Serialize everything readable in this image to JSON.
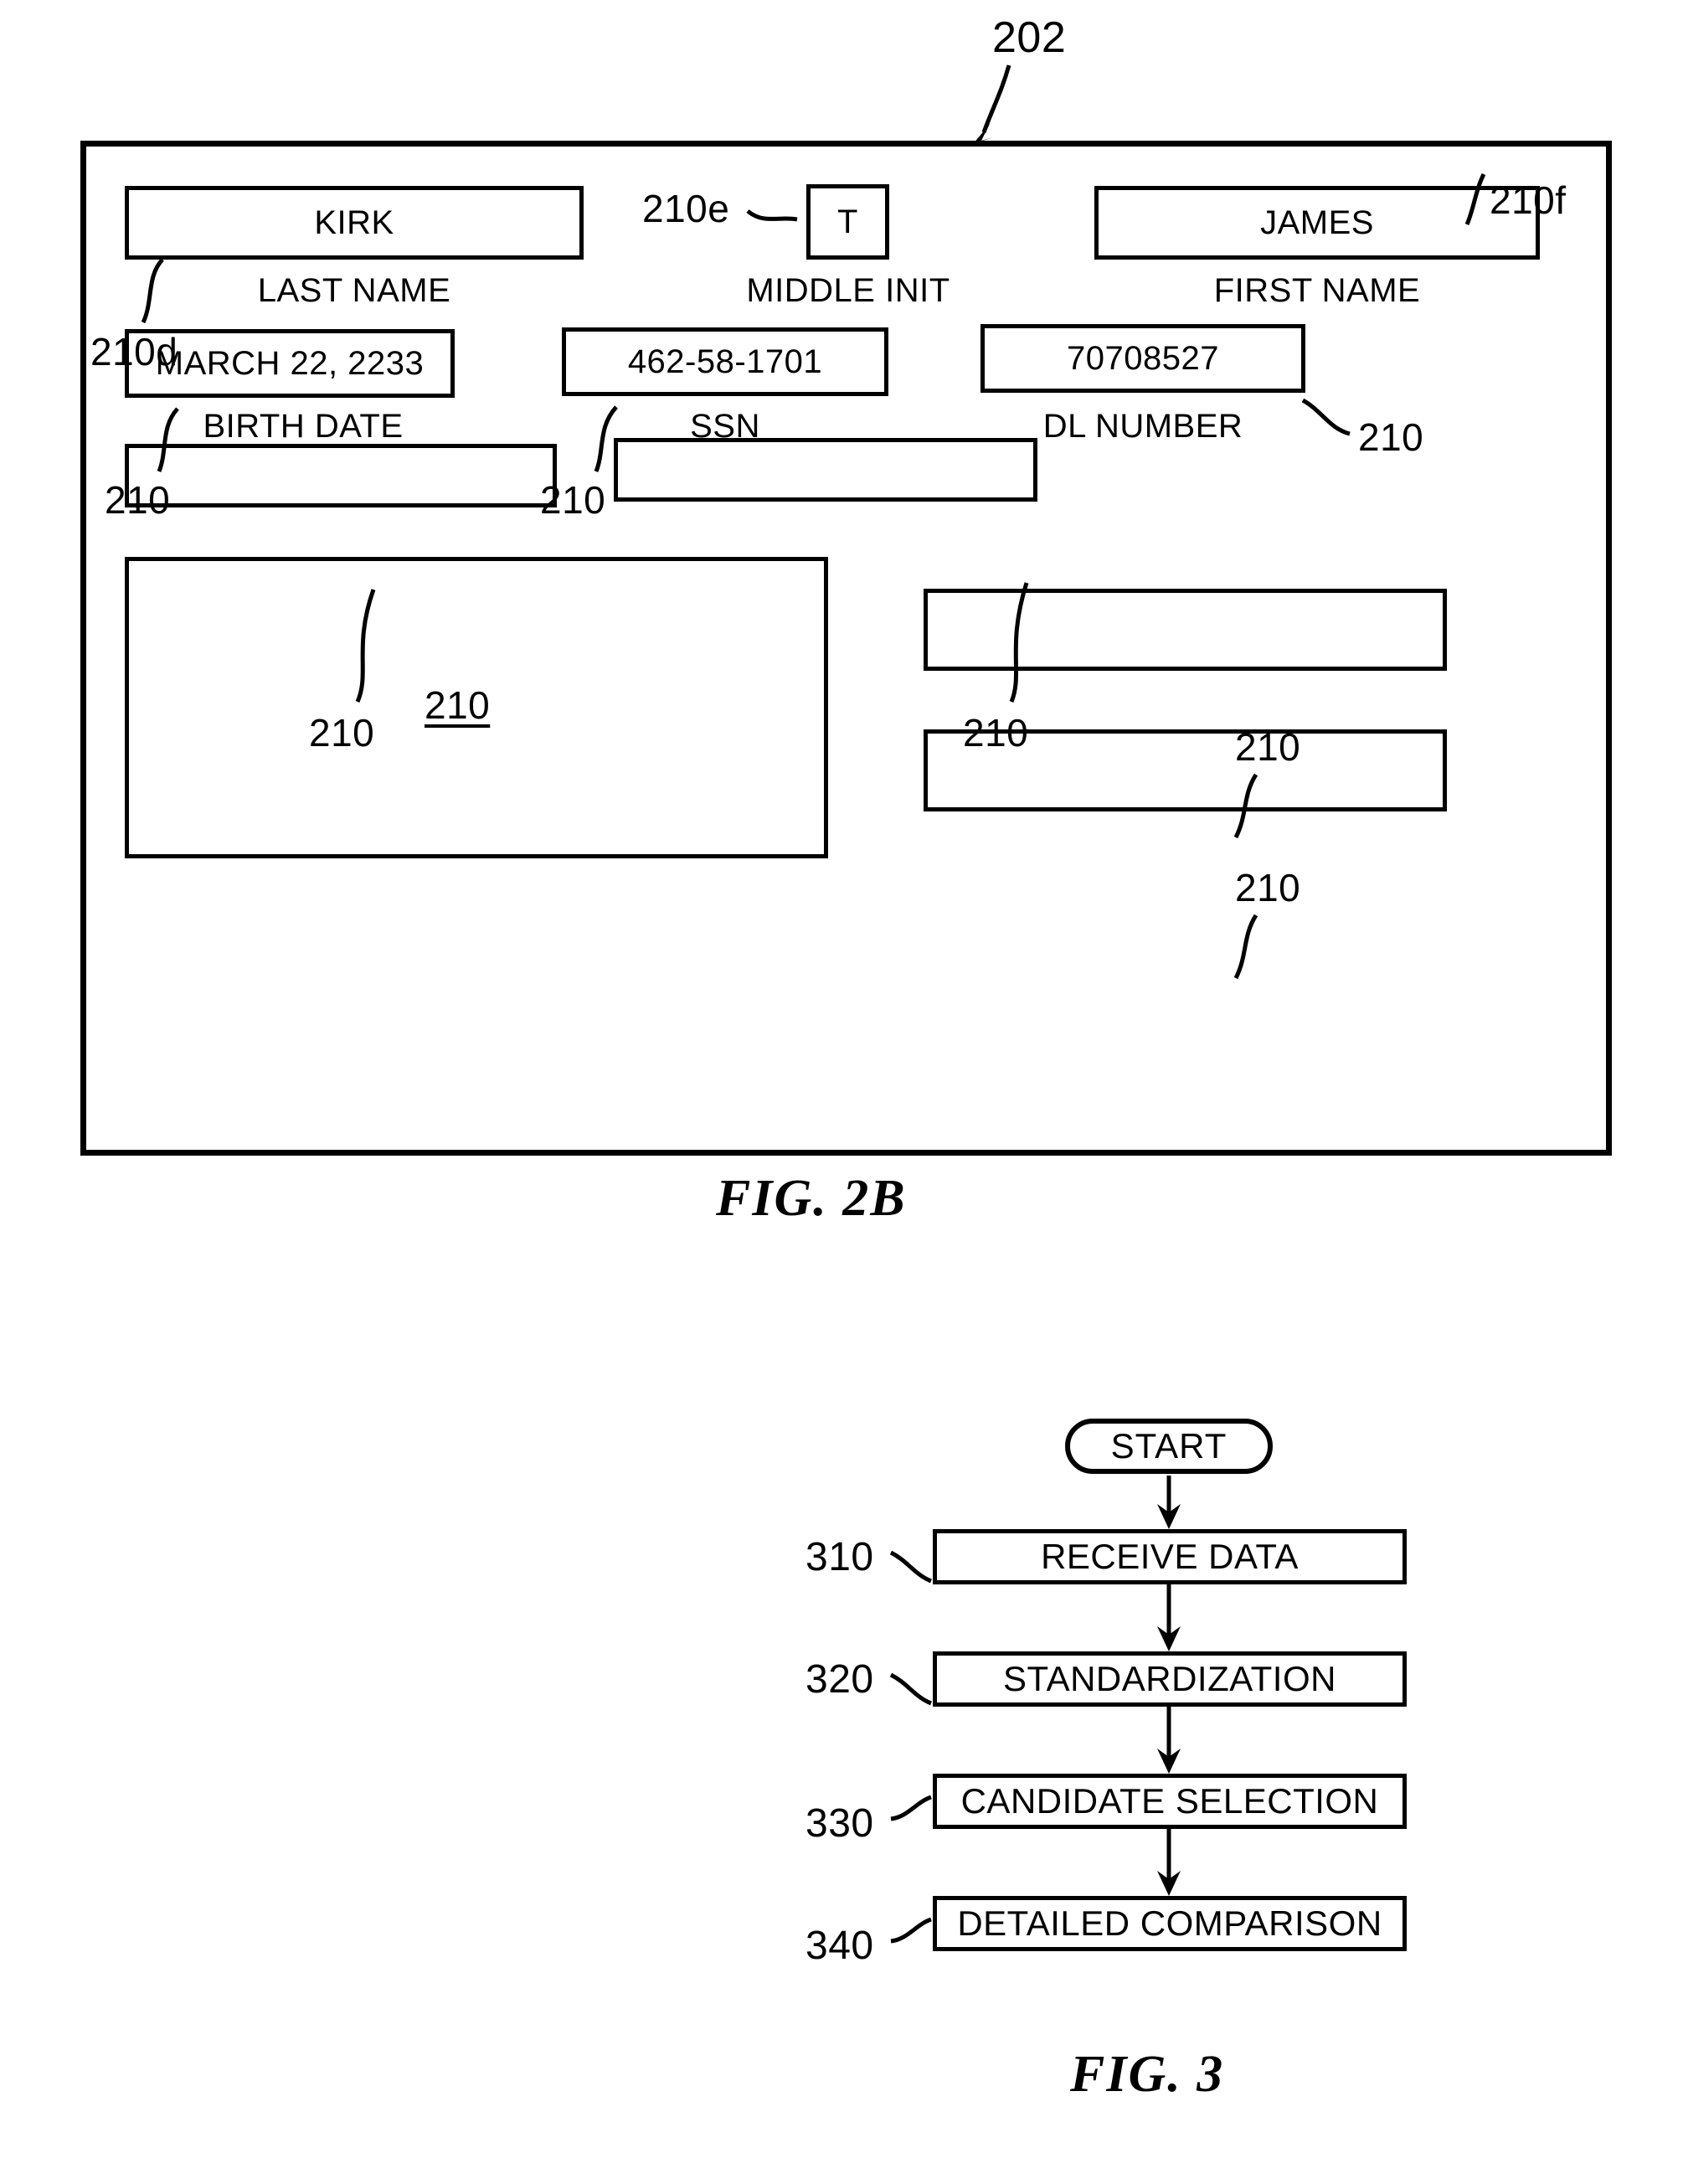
{
  "figure_2b": {
    "caption": "FIG. 2B",
    "frame_ref": "202",
    "fields": [
      {
        "value": "KIRK",
        "label": "LAST NAME",
        "ref": "210d"
      },
      {
        "value": "T",
        "label": "MIDDLE INIT",
        "ref": "210e"
      },
      {
        "value": "JAMES",
        "label": "FIRST NAME",
        "ref": "210f"
      },
      {
        "value": "MARCH 22, 2233",
        "label": "BIRTH DATE",
        "ref": "210"
      },
      {
        "value": "462-58-1701",
        "label": "SSN",
        "ref": "210"
      },
      {
        "value": "70708527",
        "label": "DL NUMBER",
        "ref": "210"
      }
    ],
    "blank_fields": [
      {
        "value": "",
        "label": "",
        "ref": "210"
      },
      {
        "value": "",
        "label": "",
        "ref": "210"
      },
      {
        "value": "",
        "label": "",
        "ref": "210"
      },
      {
        "value": "",
        "label": "",
        "ref": "210"
      },
      {
        "value": "",
        "label": "",
        "ref": "210"
      }
    ],
    "large_panel_ref": "210"
  },
  "figure_3": {
    "caption": "FIG. 3",
    "start_label": "START",
    "steps": [
      {
        "ref": "310",
        "label": "RECEIVE DATA"
      },
      {
        "ref": "320",
        "label": "STANDARDIZATION"
      },
      {
        "ref": "330",
        "label": "CANDIDATE SELECTION"
      },
      {
        "ref": "340",
        "label": "DETAILED COMPARISON"
      }
    ]
  },
  "colors": {
    "ink": "#000000",
    "paper": "#ffffff"
  }
}
